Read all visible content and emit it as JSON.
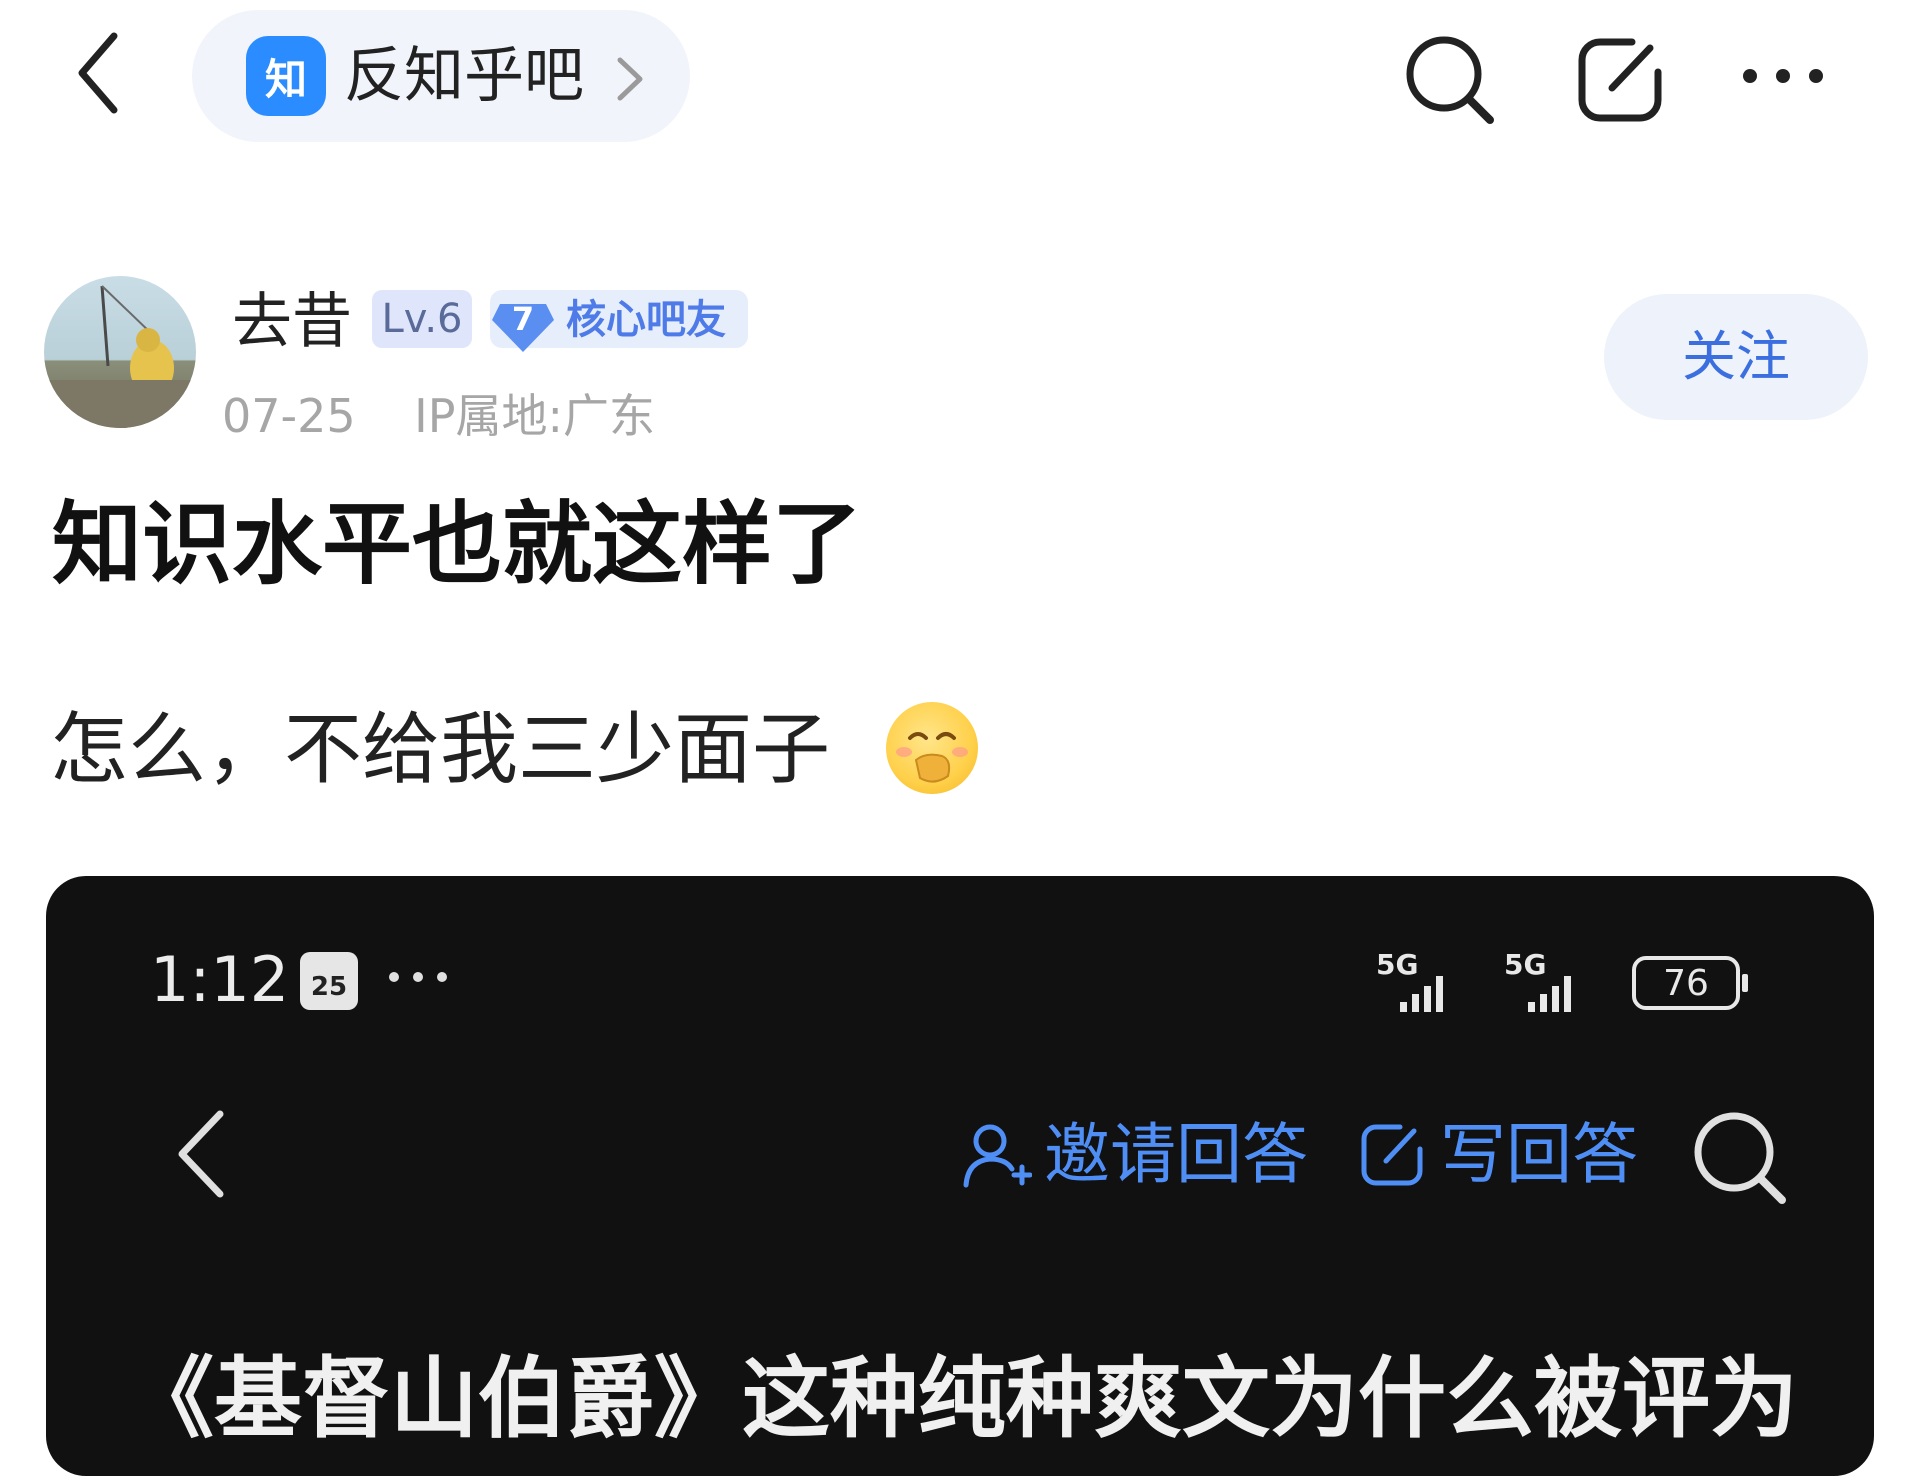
{
  "header": {
    "forum_logo_text": "知",
    "forum_name": "反知乎吧",
    "icons": [
      "back-icon",
      "chevron-right-icon",
      "search-icon",
      "edit-icon",
      "more-icon"
    ]
  },
  "author": {
    "name": "去昔",
    "level": "Lv.6",
    "core_number": "7",
    "core_label": "核心吧友",
    "date": "07-25",
    "ip_location": "IP属地:广东",
    "follow_label": "关注"
  },
  "post": {
    "title": "知识水平也就这样了",
    "body": "怎么，不给我三少面子",
    "emoji": "covering-mouth-emoji"
  },
  "embedded_screenshot": {
    "time": "1:12",
    "calendar_day": "25",
    "signal_1": "5G",
    "signal_2": "5G",
    "battery": "76",
    "invite_label": "邀请回答",
    "write_label": "写回答",
    "question_title": "《基督山伯爵》这种纯种爽文为什么被评为"
  },
  "colors": {
    "accent_blue": "#3b6fe0",
    "logo_blue": "#2a8cff",
    "dark_bg": "#111111"
  }
}
